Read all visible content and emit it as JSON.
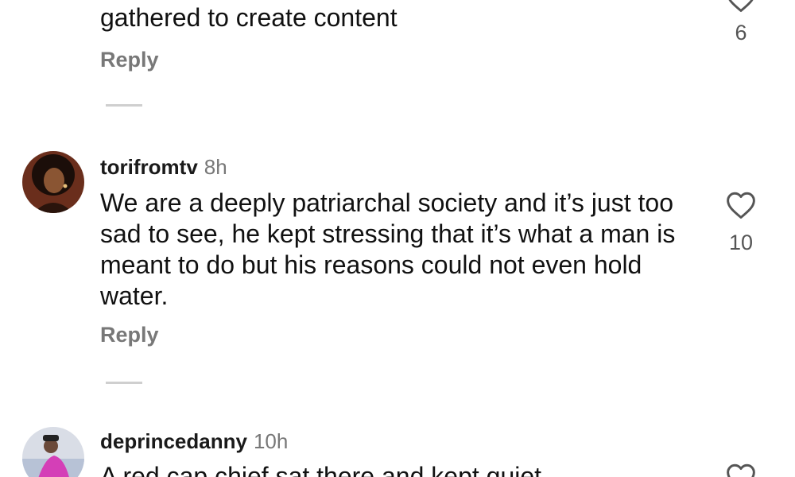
{
  "comments": [
    {
      "username": "",
      "timestamp": "",
      "text": "gathered to create content",
      "reply_label": "Reply",
      "likes": "6"
    },
    {
      "username": "torifromtv",
      "timestamp": "8h",
      "text": "We are a deeply patriarchal society and it’s just too sad to see, he kept stressing that it’s what a man is meant to do but his reasons could not even hold water.",
      "reply_label": "Reply",
      "likes": "10"
    },
    {
      "username": "deprincedanny",
      "timestamp": "10h",
      "text": "A red cap chief sat there and kept quiet",
      "reply_label": "",
      "likes": ""
    }
  ],
  "icons": {
    "like": "heart-icon",
    "view_replies": "divider-line"
  },
  "colors": {
    "text": "#111111",
    "secondary": "#787878",
    "background": "#ffffff"
  }
}
